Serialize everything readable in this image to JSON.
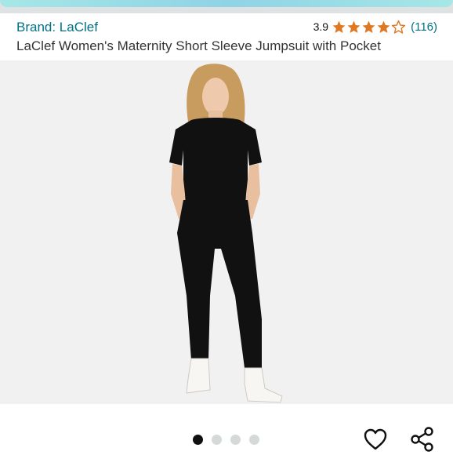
{
  "header": {
    "brand_label": "Brand: LaClef",
    "rating_value": "3.9",
    "rating_count": "(116)",
    "rating_stars": 3.9,
    "title": "LaClef Women's Maternity Short Sleeve Jumpsuit with Pocket"
  },
  "gallery": {
    "image_count": 4,
    "active_index": 0
  },
  "actions": {
    "wishlist_icon": "heart-outline-icon",
    "share_icon": "share-icon"
  },
  "colors": {
    "link": "#007185",
    "star": "#de7921",
    "dot_active": "#0f1111",
    "dot_inactive": "#d5d9d9"
  }
}
